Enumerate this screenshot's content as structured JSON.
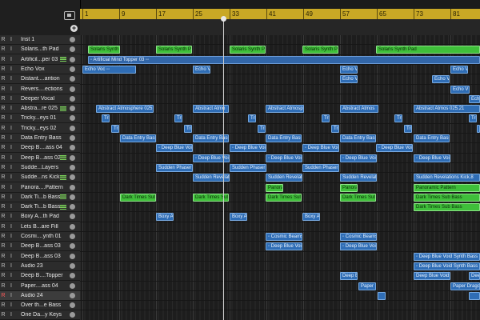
{
  "ruler": {
    "bars": [
      "1",
      "9",
      "17",
      "25",
      "33",
      "41",
      "49",
      "57",
      "65",
      "73",
      "81"
    ]
  },
  "header": {
    "add_label": "+"
  },
  "tracks": [
    {
      "name": "Inst 1",
      "r": "R",
      "i": "I"
    },
    {
      "name": "Solaris...th Pad",
      "r": "R",
      "i": "I"
    },
    {
      "name": "Artificil...per 03",
      "r": "R",
      "i": "I",
      "meter": true
    },
    {
      "name": "Echo Vox",
      "r": "R",
      "i": "I"
    },
    {
      "name": "Distant....arition",
      "r": "R",
      "i": "I"
    },
    {
      "name": "Revers....ections",
      "r": "R",
      "i": "I"
    },
    {
      "name": "Deeper Vocal",
      "r": "R",
      "i": "I"
    },
    {
      "name": "Abstra...re 025",
      "r": "R",
      "i": "I",
      "meter": true
    },
    {
      "name": "Tricky...eys 01",
      "r": "R",
      "i": "I"
    },
    {
      "name": "Tricky...eys 02",
      "r": "R",
      "i": "I"
    },
    {
      "name": "Data Entry Bass",
      "r": "R",
      "i": "I"
    },
    {
      "name": "Deep B....ass 04",
      "r": "R",
      "i": "I"
    },
    {
      "name": "Deep B...ass 02",
      "r": "R",
      "i": "I",
      "meter": true
    },
    {
      "name": "Sudde...Layers",
      "r": "R",
      "i": "I"
    },
    {
      "name": "Sudde...ns Kick",
      "r": "R",
      "i": "I",
      "meter": true
    },
    {
      "name": "Panora....Pattern",
      "r": "R",
      "i": "I"
    },
    {
      "name": "Dark Ti...b Bass",
      "r": "R",
      "i": "I",
      "meter": true
    },
    {
      "name": "Dark Ti...b Bass",
      "r": "R",
      "i": "I",
      "meter": true
    },
    {
      "name": "Boxy A...th Pad",
      "r": "R",
      "i": "I"
    },
    {
      "name": "Lets B...are Fill",
      "r": "R",
      "i": "I"
    },
    {
      "name": "Cosmi....ynth 01",
      "r": "R",
      "i": "I"
    },
    {
      "name": "Deep B...ass 03",
      "r": "R",
      "i": "I"
    },
    {
      "name": "Deep B...ass 03",
      "r": "R",
      "i": "I"
    },
    {
      "name": "Audio 23",
      "r": "R",
      "i": "I"
    },
    {
      "name": "Deep B....Topper",
      "r": "R",
      "i": "I"
    },
    {
      "name": "Paper....ass 04",
      "r": "R",
      "i": "I"
    },
    {
      "name": "Audio 24",
      "r": "R",
      "i": "I",
      "selected": true
    },
    {
      "name": "Over th...e Bass",
      "r": "R",
      "i": "I"
    },
    {
      "name": "One Da...y Keys",
      "r": "R",
      "i": "I"
    }
  ],
  "regions": [
    {
      "row": 1,
      "l": 10,
      "w": 40,
      "label": "Solaris Synth",
      "color": "green"
    },
    {
      "row": 1,
      "l": 95,
      "w": 45,
      "label": "Solaris Synth Pa",
      "color": "green"
    },
    {
      "row": 1,
      "l": 187,
      "w": 45,
      "label": "Solaris Synth Pa",
      "color": "green"
    },
    {
      "row": 1,
      "l": 278,
      "w": 45,
      "label": "Solaris Synth Pa",
      "color": "green"
    },
    {
      "row": 1,
      "l": 370,
      "w": 130,
      "label": "Solaris Synth Pad",
      "color": "green"
    },
    {
      "row": 2,
      "l": 10,
      "w": 490,
      "label": "◦ Artificial Mind Topper 03 ◦◦",
      "color": "wide"
    },
    {
      "row": 3,
      "l": 3,
      "w": 67,
      "label": "Echo Voc ◦◦",
      "color": "blue"
    },
    {
      "row": 3,
      "l": 141,
      "w": 22,
      "label": "Echo V",
      "color": "blue"
    },
    {
      "row": 3,
      "l": 325,
      "w": 22,
      "label": "Echo V",
      "color": "blue"
    },
    {
      "row": 3,
      "l": 463,
      "w": 22,
      "label": "Echo V",
      "color": "blue"
    },
    {
      "row": 4,
      "l": 325,
      "w": 22,
      "label": "Echo V",
      "color": "blue"
    },
    {
      "row": 4,
      "l": 440,
      "w": 22,
      "label": "Echo V",
      "color": "blue"
    },
    {
      "row": 5,
      "l": 463,
      "w": 24,
      "label": "Echo V",
      "color": "blue"
    },
    {
      "row": 6,
      "l": 486,
      "w": 14,
      "label": "Echo V",
      "color": "blue"
    },
    {
      "row": 7,
      "l": 20,
      "w": 72,
      "label": "Abstract Atmosphere 025",
      "color": "blue"
    },
    {
      "row": 7,
      "l": 141,
      "w": 45,
      "label": "Abstract Atmo",
      "color": "blue"
    },
    {
      "row": 7,
      "l": 232,
      "w": 48,
      "label": "Abstract Atmosp",
      "color": "blue"
    },
    {
      "row": 7,
      "l": 325,
      "w": 48,
      "label": "Abstract Atmos",
      "color": "blue"
    },
    {
      "row": 7,
      "l": 417,
      "w": 83,
      "label": "Abstract Atmos 025.21",
      "color": "blue"
    },
    {
      "row": 8,
      "l": 27,
      "w": 10,
      "label": "Tri",
      "color": "blue"
    },
    {
      "row": 8,
      "l": 118,
      "w": 10,
      "label": "Tri",
      "color": "blue"
    },
    {
      "row": 8,
      "l": 210,
      "w": 10,
      "label": "Tri",
      "color": "blue"
    },
    {
      "row": 8,
      "l": 302,
      "w": 10,
      "label": "Tri",
      "color": "blue"
    },
    {
      "row": 8,
      "l": 393,
      "w": 10,
      "label": "Tri",
      "color": "blue"
    },
    {
      "row": 8,
      "l": 486,
      "w": 10,
      "label": "Tri",
      "color": "blue"
    },
    {
      "row": 9,
      "l": 39,
      "w": 10,
      "label": "Tri",
      "color": "blue"
    },
    {
      "row": 9,
      "l": 130,
      "w": 10,
      "label": "Tri",
      "color": "blue"
    },
    {
      "row": 9,
      "l": 222,
      "w": 10,
      "label": "Tri",
      "color": "blue"
    },
    {
      "row": 9,
      "l": 314,
      "w": 10,
      "label": "Tri",
      "color": "blue"
    },
    {
      "row": 9,
      "l": 405,
      "w": 10,
      "label": "Tri",
      "color": "blue"
    },
    {
      "row": 9,
      "l": 496,
      "w": 4,
      "label": "",
      "color": "blue"
    },
    {
      "row": 10,
      "l": 50,
      "w": 45,
      "label": "Data Entry Bass",
      "color": "blue"
    },
    {
      "row": 10,
      "l": 141,
      "w": 45,
      "label": "Data Entry Bass",
      "color": "blue"
    },
    {
      "row": 10,
      "l": 232,
      "w": 45,
      "label": "Data Entry Bass",
      "color": "blue"
    },
    {
      "row": 10,
      "l": 325,
      "w": 45,
      "label": "Data Entry Bass",
      "color": "blue"
    },
    {
      "row": 10,
      "l": 417,
      "w": 45,
      "label": "Data Entry Bass",
      "color": "blue"
    },
    {
      "row": 11,
      "l": 95,
      "w": 46,
      "label": "◦ Deep Blue Void",
      "color": "blue"
    },
    {
      "row": 11,
      "l": 187,
      "w": 46,
      "label": "◦ Deep Blue Void",
      "color": "blue"
    },
    {
      "row": 11,
      "l": 278,
      "w": 46,
      "label": "◦ Deep Blue Void",
      "color": "blue"
    },
    {
      "row": 11,
      "l": 370,
      "w": 46,
      "label": "◦ Deep Blue Void",
      "color": "blue"
    },
    {
      "row": 12,
      "l": 141,
      "w": 46,
      "label": "◦ Deep Blue Void",
      "color": "blue"
    },
    {
      "row": 12,
      "l": 232,
      "w": 46,
      "label": "◦ Deep Blue Void",
      "color": "blue"
    },
    {
      "row": 12,
      "l": 325,
      "w": 46,
      "label": "◦ Deep Blue Void",
      "color": "blue"
    },
    {
      "row": 12,
      "l": 417,
      "w": 46,
      "label": "◦ Deep Blue Void",
      "color": "blue"
    },
    {
      "row": 13,
      "l": 95,
      "w": 46,
      "label": "Sudden Phaser L",
      "color": "blue"
    },
    {
      "row": 13,
      "l": 187,
      "w": 46,
      "label": "Sudden Phaser L",
      "color": "blue"
    },
    {
      "row": 13,
      "l": 278,
      "w": 46,
      "label": "Sudden Phaser L",
      "color": "blue"
    },
    {
      "row": 14,
      "l": 141,
      "w": 46,
      "label": "Sudden Revelati",
      "color": "blue"
    },
    {
      "row": 14,
      "l": 232,
      "w": 46,
      "label": "Sudden Revelati",
      "color": "blue"
    },
    {
      "row": 14,
      "l": 325,
      "w": 46,
      "label": "Sudden Revelati",
      "color": "blue"
    },
    {
      "row": 14,
      "l": 417,
      "w": 83,
      "label": "Sudden Revelations Kick.8",
      "color": "blue"
    },
    {
      "row": 15,
      "l": 232,
      "w": 22,
      "label": "Panorami",
      "color": "green"
    },
    {
      "row": 15,
      "l": 325,
      "w": 22,
      "label": "Panorami",
      "color": "green"
    },
    {
      "row": 15,
      "l": 417,
      "w": 83,
      "label": "Panoramic Pattern",
      "color": "green"
    },
    {
      "row": 16,
      "l": 50,
      "w": 45,
      "label": "Dark Times Sub",
      "color": "green"
    },
    {
      "row": 16,
      "l": 141,
      "w": 45,
      "label": "Dark Times Sub",
      "color": "green"
    },
    {
      "row": 16,
      "l": 232,
      "w": 45,
      "label": "Dark Times Sub",
      "color": "green"
    },
    {
      "row": 16,
      "l": 325,
      "w": 45,
      "label": "Dark Times Sub",
      "color": "green"
    },
    {
      "row": 16,
      "l": 417,
      "w": 83,
      "label": "Dark Times Sub Bass",
      "color": "green"
    },
    {
      "row": 17,
      "l": 417,
      "w": 83,
      "label": "Dark Times Sub Bass",
      "color": "green"
    },
    {
      "row": 18,
      "l": 95,
      "w": 22,
      "label": "Boxy A",
      "color": "blue"
    },
    {
      "row": 18,
      "l": 187,
      "w": 22,
      "label": "Boxy A",
      "color": "blue"
    },
    {
      "row": 18,
      "l": 278,
      "w": 22,
      "label": "Boxy A",
      "color": "blue"
    },
    {
      "row": 20,
      "l": 232,
      "w": 46,
      "label": "◦ Cosmic Beams",
      "color": "blue"
    },
    {
      "row": 20,
      "l": 325,
      "w": 46,
      "label": "◦ Cosmic Beams",
      "color": "blue"
    },
    {
      "row": 21,
      "l": 232,
      "w": 46,
      "label": "◦ Deep Blue Void",
      "color": "blue"
    },
    {
      "row": 21,
      "l": 325,
      "w": 46,
      "label": "◦ Deep Blue Void",
      "color": "blue"
    },
    {
      "row": 22,
      "l": 417,
      "w": 83,
      "label": "◦ Deep Blue Void Synth Bass 03",
      "color": "blue"
    },
    {
      "row": 23,
      "l": 417,
      "w": 83,
      "label": "◦ Deep Blue Void Synth Bass 03",
      "color": "blue"
    },
    {
      "row": 24,
      "l": 325,
      "w": 22,
      "label": "Deep Blue",
      "color": "blue"
    },
    {
      "row": 24,
      "l": 417,
      "w": 46,
      "label": "Deep Blue Void",
      "color": "blue"
    },
    {
      "row": 24,
      "l": 486,
      "w": 14,
      "label": "Deep",
      "color": "blue"
    },
    {
      "row": 25,
      "l": 348,
      "w": 22,
      "label": "Paper D",
      "color": "blue"
    },
    {
      "row": 25,
      "l": 463,
      "w": 37,
      "label": "Paper Dragons",
      "color": "blue"
    },
    {
      "row": 26,
      "l": 372,
      "w": 10,
      "label": "",
      "color": "blue"
    },
    {
      "row": 26,
      "l": 486,
      "w": 14,
      "label": "",
      "color": "blue"
    }
  ]
}
